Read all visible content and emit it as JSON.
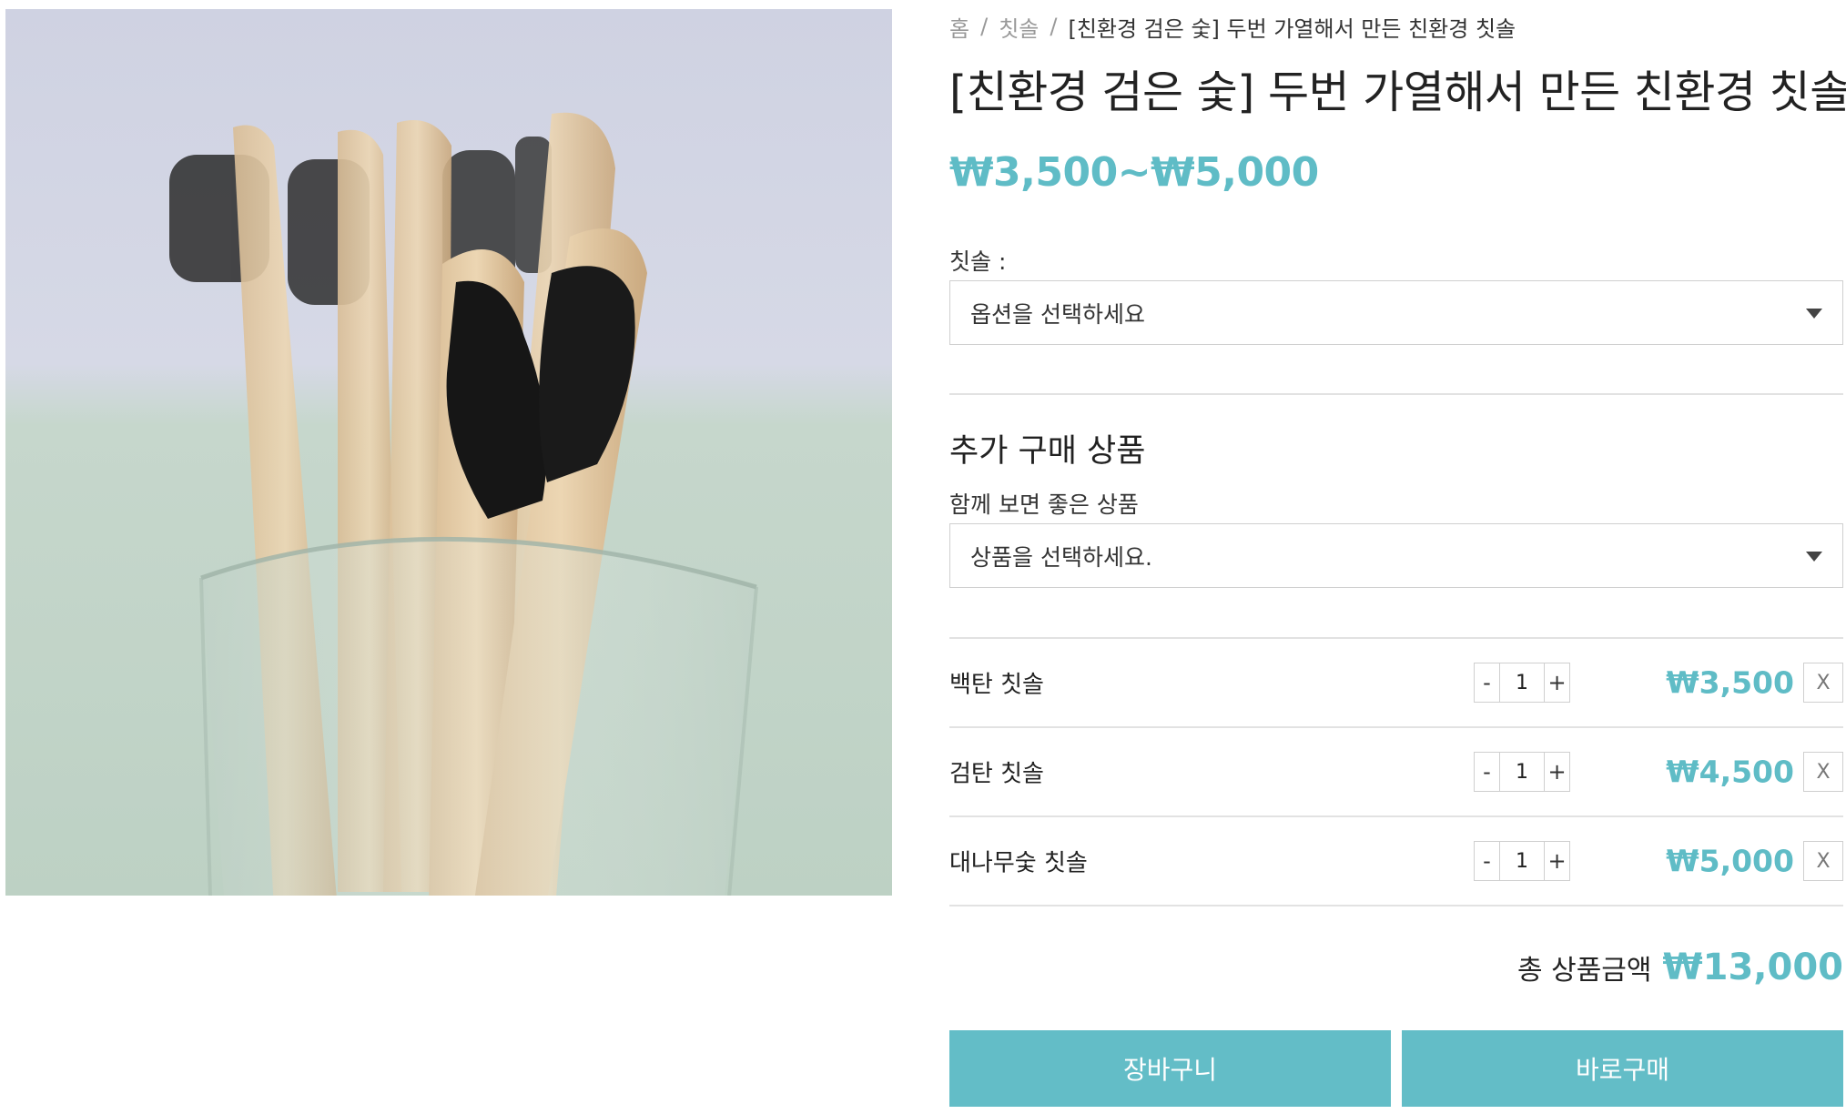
{
  "breadcrumb": {
    "home": "홈",
    "category": "칫솔",
    "current": "[친환경 검은 숯] 두번 가열해서 만든 친환경 칫솔",
    "separator": "/"
  },
  "product": {
    "title": "[친환경 검은 숯] 두번 가열해서 만든 친환경 칫솔",
    "price_range": "₩3,500~₩5,000",
    "image_alt": "bamboo-charcoal-toothbrushes-in-glass"
  },
  "option": {
    "label": "칫솔 :",
    "placeholder": "옵션을 선택하세요"
  },
  "addon": {
    "title": "추가 구매 상품",
    "subtitle": "함께 보면 좋은 상품",
    "placeholder": "상품을 선택하세요."
  },
  "items": [
    {
      "name": "백탄 칫솔",
      "qty": "1",
      "price": "₩3,500"
    },
    {
      "name": "검탄 칫솔",
      "qty": "1",
      "price": "₩4,500"
    },
    {
      "name": "대나무숯 칫솔",
      "qty": "1",
      "price": "₩5,000"
    }
  ],
  "qty_controls": {
    "minus": "-",
    "plus": "+",
    "remove": "X"
  },
  "total": {
    "label": "총 상품금액",
    "value": "₩13,000"
  },
  "buttons": {
    "cart": "장바구니",
    "buy_now": "바로구매"
  },
  "colors": {
    "accent": "#63bdc7",
    "price": "#5fbcc6"
  }
}
